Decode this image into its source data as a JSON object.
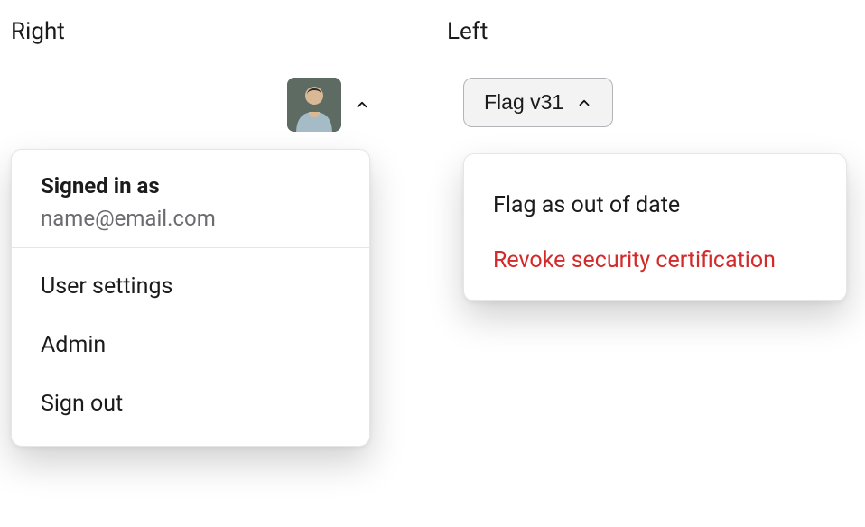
{
  "right_example": {
    "label": "Right",
    "signin_title": "Signed in as",
    "signin_email": "name@email.com",
    "menu_items": [
      "User settings",
      "Admin",
      "Sign out"
    ]
  },
  "left_example": {
    "label": "Left",
    "button_label": "Flag v31",
    "menu_items": [
      {
        "label": "Flag as out of date",
        "danger": false
      },
      {
        "label": "Revoke security certification",
        "danger": true
      }
    ]
  }
}
